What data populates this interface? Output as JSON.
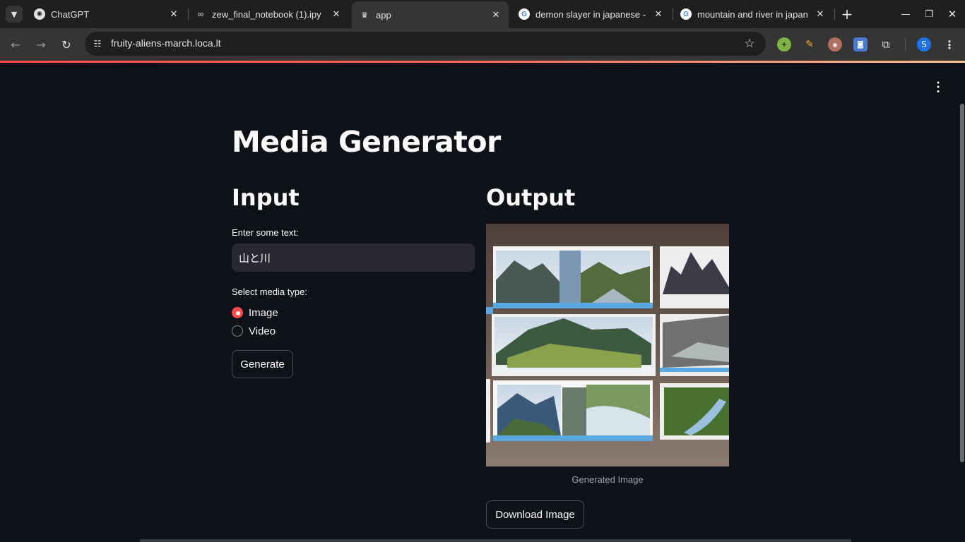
{
  "browser": {
    "tabs": [
      {
        "title": "ChatGPT",
        "icon": "chatgpt-icon"
      },
      {
        "title": "zew_final_notebook (1).ipy",
        "icon": "colab-icon"
      },
      {
        "title": "app",
        "icon": "streamlit-icon"
      },
      {
        "title": "demon slayer in japanese -",
        "icon": "google-icon"
      },
      {
        "title": "mountain and river in japan",
        "icon": "google-icon"
      }
    ],
    "active_tab": 2,
    "url": "fruity-aliens-march.loca.lt",
    "profile_initial": "S",
    "colors": {
      "tabbar": "#1f1f1f",
      "toolbar": "#353535",
      "accent": "#ff4b4b"
    }
  },
  "page": {
    "title": "Media Generator",
    "input_heading": "Input",
    "output_heading": "Output",
    "text_label": "Enter some text:",
    "text_value": "山と川",
    "media_label": "Select media type:",
    "media_options": [
      "Image",
      "Video"
    ],
    "selected_media": "Image",
    "generate_label": "Generate",
    "image_caption": "Generated Image",
    "download_label": "Download Image"
  }
}
